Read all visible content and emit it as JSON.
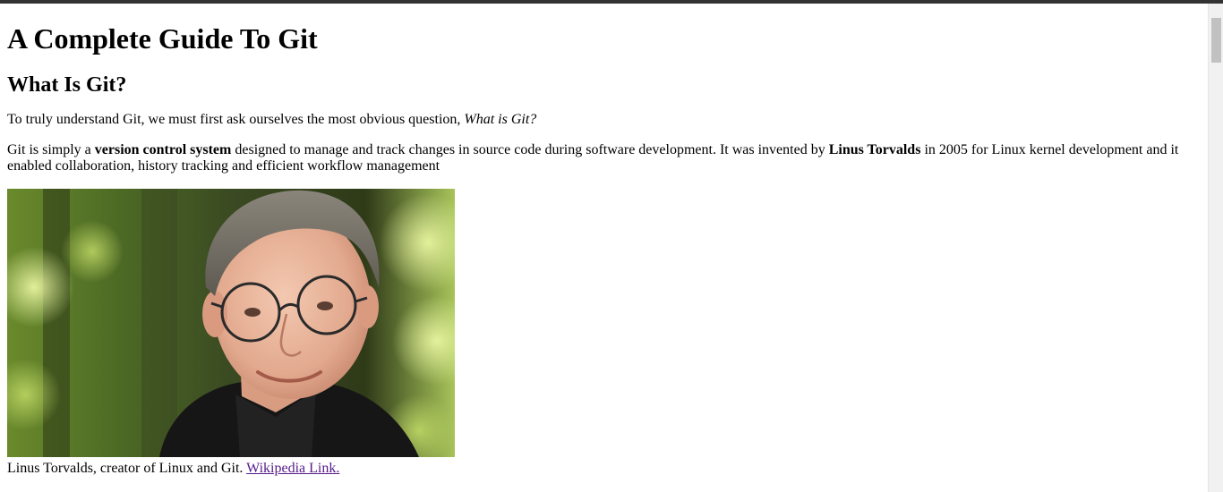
{
  "page": {
    "title": "A Complete Guide To Git",
    "section_heading": "What Is Git?"
  },
  "intro": {
    "text": "To truly understand Git, we must first ask ourselves the most obvious question, ",
    "question": "What is Git?"
  },
  "definition": {
    "t1": "Git is simply a ",
    "b1": "version control system",
    "t2": " designed to manage and track changes in source code during software development. It was invented by ",
    "b2": "Linus Torvalds",
    "t3": " in 2005 for Linux kernel development and it enabled collaboration, history tracking and efficient workflow management"
  },
  "figure": {
    "caption": "Linus Torvalds, creator of Linux and Git. ",
    "link_text": "Wikipedia Link."
  },
  "colors": {
    "link_visited": "#551a8b",
    "top_bar": "#333333"
  }
}
